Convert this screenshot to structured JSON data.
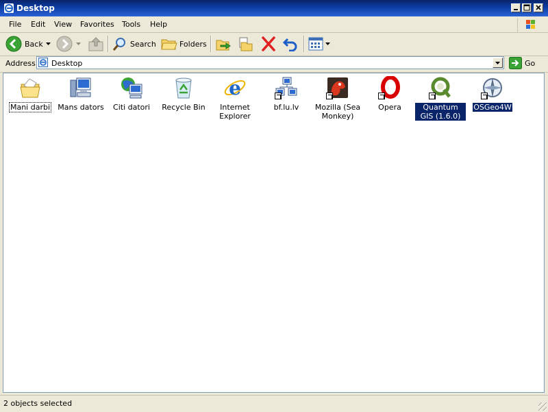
{
  "window": {
    "title": "Desktop"
  },
  "menu": [
    "File",
    "Edit",
    "View",
    "Favorites",
    "Tools",
    "Help"
  ],
  "toolbar": {
    "back_label": "Back",
    "search_label": "Search",
    "folders_label": "Folders"
  },
  "address": {
    "label": "Address",
    "value": "Desktop",
    "go_label": "Go"
  },
  "items": [
    {
      "label": "Mani darbi",
      "icon": "my-documents-icon",
      "selected": false,
      "focused": true,
      "shortcut": false
    },
    {
      "label": "Mans dators",
      "icon": "my-computer-icon",
      "selected": false,
      "focused": false,
      "shortcut": false
    },
    {
      "label": "Citi datori",
      "icon": "network-places-icon",
      "selected": false,
      "focused": false,
      "shortcut": false
    },
    {
      "label": "Recycle Bin",
      "icon": "recycle-bin-icon",
      "selected": false,
      "focused": false,
      "shortcut": false
    },
    {
      "label": "Internet Explorer",
      "icon": "internet-explorer-icon",
      "selected": false,
      "focused": false,
      "shortcut": false
    },
    {
      "label": "bf.lu.lv",
      "icon": "network-connection-icon",
      "selected": false,
      "focused": false,
      "shortcut": true
    },
    {
      "label": "Mozilla (Sea Monkey)",
      "icon": "seamonkey-icon",
      "selected": false,
      "focused": false,
      "shortcut": true
    },
    {
      "label": "Opera",
      "icon": "opera-icon",
      "selected": false,
      "focused": false,
      "shortcut": true
    },
    {
      "label": "Quantum GIS (1.6.0)",
      "icon": "qgis-icon",
      "selected": true,
      "focused": false,
      "shortcut": true
    },
    {
      "label": "OSGeo4W",
      "icon": "osgeo4w-icon",
      "selected": true,
      "focused": false,
      "shortcut": true
    }
  ],
  "status": {
    "text": "2 objects selected"
  },
  "colors": {
    "selection": "#0a246a",
    "titlebar": "#0a3a9e",
    "chrome": "#ece9d8"
  }
}
